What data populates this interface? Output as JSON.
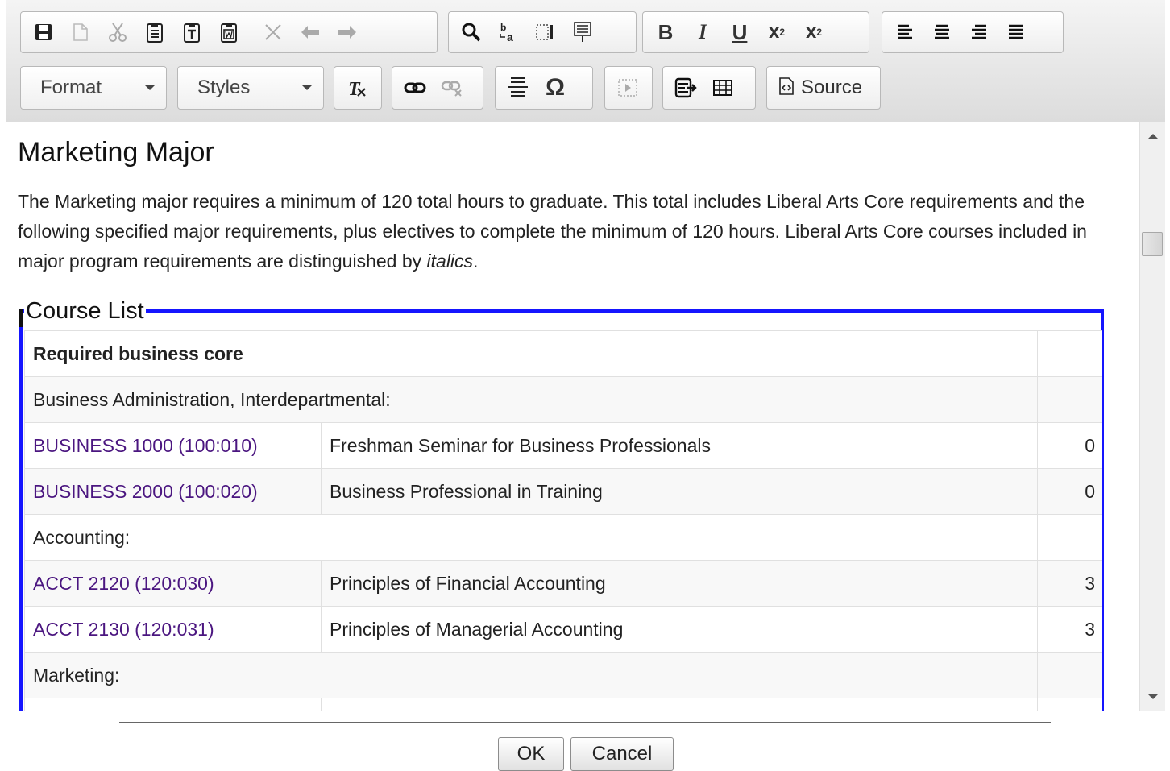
{
  "toolbar": {
    "row1": {
      "group1": [
        {
          "name": "save-icon",
          "glyph": "💾",
          "enabled": true
        },
        {
          "name": "new-page-icon",
          "glyph": "🗋",
          "enabled": false
        },
        {
          "name": "cut-icon",
          "glyph": "✂",
          "enabled": false
        },
        {
          "name": "paste-icon",
          "glyph": "📋",
          "enabled": true
        },
        {
          "name": "paste-text-icon",
          "glyph": "📋",
          "enabled": true
        },
        {
          "name": "paste-word-icon",
          "glyph": "📋",
          "enabled": true
        },
        {
          "name": "remove-format-x-icon",
          "glyph": "✕",
          "enabled": false
        },
        {
          "name": "undo-icon",
          "glyph": "↶",
          "enabled": false
        },
        {
          "name": "redo-icon",
          "glyph": "↷",
          "enabled": false
        }
      ],
      "group2": [
        {
          "name": "find-icon",
          "glyph": "🔍",
          "enabled": true
        },
        {
          "name": "replace-icon",
          "glyph": "ab",
          "enabled": true
        },
        {
          "name": "select-all-icon",
          "glyph": "▭",
          "enabled": true
        },
        {
          "name": "spellcheck-icon",
          "glyph": "≣",
          "enabled": true
        }
      ],
      "group3": [
        {
          "name": "bold-icon",
          "glyph": "B",
          "enabled": true
        },
        {
          "name": "italic-icon",
          "glyph": "I",
          "enabled": true
        },
        {
          "name": "underline-icon",
          "glyph": "U",
          "enabled": true
        },
        {
          "name": "superscript-icon",
          "glyph": "x²",
          "enabled": true
        },
        {
          "name": "subscript-icon",
          "glyph": "x₂",
          "enabled": true
        }
      ],
      "group4": [
        {
          "name": "align-left-icon",
          "glyph": "≡",
          "enabled": true
        },
        {
          "name": "align-center-icon",
          "glyph": "≡",
          "enabled": true
        },
        {
          "name": "align-right-icon",
          "glyph": "≡",
          "enabled": true
        },
        {
          "name": "justify-icon",
          "glyph": "≡",
          "enabled": true
        }
      ]
    },
    "format_label": "Format",
    "styles_label": "Styles",
    "source_label": "Source"
  },
  "content": {
    "title": "Marketing Major",
    "intro_text": "The Marketing major requires a minimum of 120 total hours to graduate. This total includes Liberal Arts Core requirements and the following specified major requirements, plus electives to complete the minimum of 120 hours. Liberal Arts Core courses included in major program requirements are distinguished by ",
    "intro_italic": "italics",
    "intro_end": ".",
    "legend": "Course List",
    "rows": [
      {
        "type": "heading",
        "text": "Required business core"
      },
      {
        "type": "section",
        "text": "Business Administration, Interdepartmental:"
      },
      {
        "type": "course",
        "code": "BUSINESS 1000 (100:010)",
        "title": "Freshman Seminar for Business Professionals",
        "hours": "0"
      },
      {
        "type": "course",
        "code": "BUSINESS 2000 (100:020)",
        "title": "Business Professional in Training",
        "hours": "0"
      },
      {
        "type": "section",
        "text": "Accounting:"
      },
      {
        "type": "course",
        "code": "ACCT 2120 (120:030)",
        "title": "Principles of Financial Accounting",
        "hours": "3"
      },
      {
        "type": "course",
        "code": "ACCT 2130 (120:031)",
        "title": "Principles of Managerial Accounting",
        "hours": "3"
      },
      {
        "type": "section",
        "text": "Marketing:"
      },
      {
        "type": "course",
        "code": "",
        "title": "",
        "hours": ""
      }
    ]
  },
  "footer": {
    "ok_label": "OK",
    "cancel_label": "Cancel"
  }
}
